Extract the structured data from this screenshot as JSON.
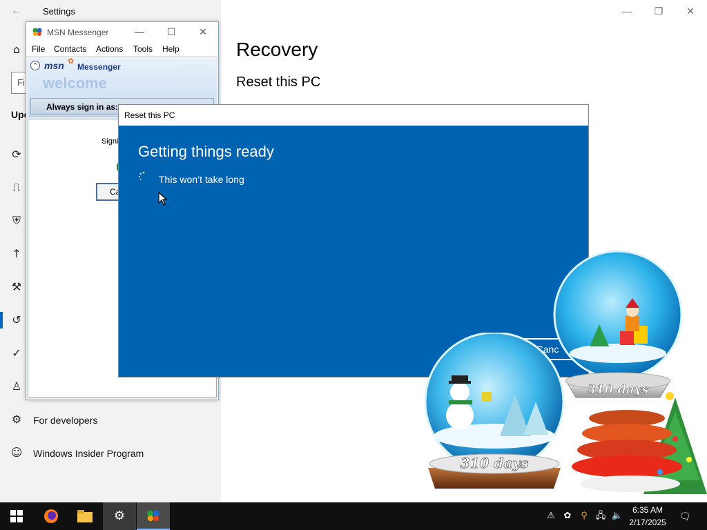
{
  "settings": {
    "title": "Settings",
    "find_placeholder": "Fi",
    "section_partial": "Upc",
    "recovery_heading": "Recovery",
    "reset_heading": "Reset this PC",
    "sidebar": {
      "items": [
        {
          "label": "For developers",
          "icon": "developer-icon"
        },
        {
          "label": "Windows Insider Program",
          "icon": "insider-icon"
        }
      ],
      "icons": [
        "home-icon",
        "sync-icon",
        "delivery-icon",
        "shield-icon",
        "backup-icon",
        "troubleshoot-icon",
        "recovery-icon",
        "activation-icon",
        "find-device-icon"
      ]
    }
  },
  "msn": {
    "title": "MSN Messenger",
    "menu": [
      "File",
      "Contacts",
      "Actions",
      "Tools",
      "Help"
    ],
    "logo": "msn",
    "logo_suffix": "Messenger",
    "welcome": "welcome",
    "always_sign_in": "Always sign in as:",
    "signing_text": "Signin",
    "cancel_partial": "Ca"
  },
  "dialog": {
    "title": "Reset this PC",
    "heading": "Getting things ready",
    "subtext": "This won’t take long",
    "cancel_partial": "Canc",
    "accent": "#0063b1"
  },
  "globes": {
    "large_days": "310 days",
    "small_days": "310 days"
  },
  "taskbar": {
    "time": "6:35 AM",
    "date": "2/17/2025",
    "apps": [
      "start-icon",
      "firefox-icon",
      "file-explorer-icon",
      "settings-icon",
      "msn-messenger-icon"
    ],
    "tray": [
      "security-alert-icon",
      "msn-tray-icon",
      "search-tray-icon",
      "network-icon",
      "volume-icon"
    ]
  }
}
